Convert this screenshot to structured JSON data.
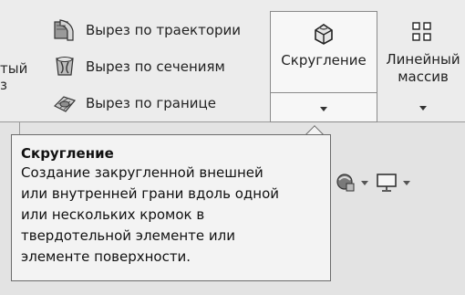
{
  "ribbon": {
    "left_partial": [
      "тый",
      "з"
    ],
    "features": [
      {
        "label": "Вырез по траектории",
        "icon": "swept-cut-icon"
      },
      {
        "label": "Вырез по сечениям",
        "icon": "lofted-cut-icon"
      },
      {
        "label": "Вырез по границе",
        "icon": "boundary-cut-icon"
      }
    ],
    "fillet": {
      "label": "Скругление",
      "icon": "fillet-icon"
    },
    "linear_pattern": {
      "label_line1": "Линейный",
      "label_line2": "массив",
      "icon": "linear-pattern-icon"
    }
  },
  "tooltip": {
    "title": "Скругление",
    "lines": [
      "Создание закругленной внешней",
      "или внутренней грани вдоль одной",
      "или нескольких кромок в",
      "твердотельной элементе или",
      "элементе поверхности."
    ]
  },
  "view_toolbar": {
    "icons": [
      "appearance-icon",
      "display-monitor-icon"
    ]
  }
}
